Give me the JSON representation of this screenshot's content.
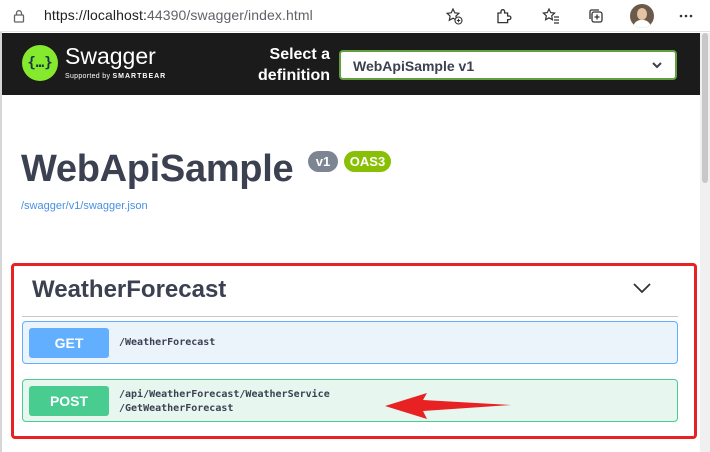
{
  "browser": {
    "url_prefix": "https://localhost:",
    "url_port": "44390",
    "url_path": "/swagger/index.html"
  },
  "swagger": {
    "brand": "Swagger",
    "brand_sub_prefix": "Supported by ",
    "brand_sub_company": "SMARTBEAR",
    "logo_glyph": "{…}",
    "select_label_line1": "Select a",
    "select_label_line2": "definition",
    "selected_definition": "WebApiSample v1"
  },
  "info": {
    "title": "WebApiSample",
    "version_badge": "v1",
    "oas_badge": "OAS3",
    "spec_link": "/swagger/v1/swagger.json"
  },
  "tag": {
    "name": "WeatherForecast",
    "operations": [
      {
        "method": "GET",
        "path_line1": "/WeatherForecast",
        "path_line2": ""
      },
      {
        "method": "POST",
        "path_line1": "/api/WeatherForecast/WeatherService",
        "path_line2": "/GetWeatherForecast"
      }
    ]
  },
  "colors": {
    "get": "#61affe",
    "post": "#49cc90",
    "highlight": "#e82222",
    "swagger_green": "#85ea2d"
  }
}
